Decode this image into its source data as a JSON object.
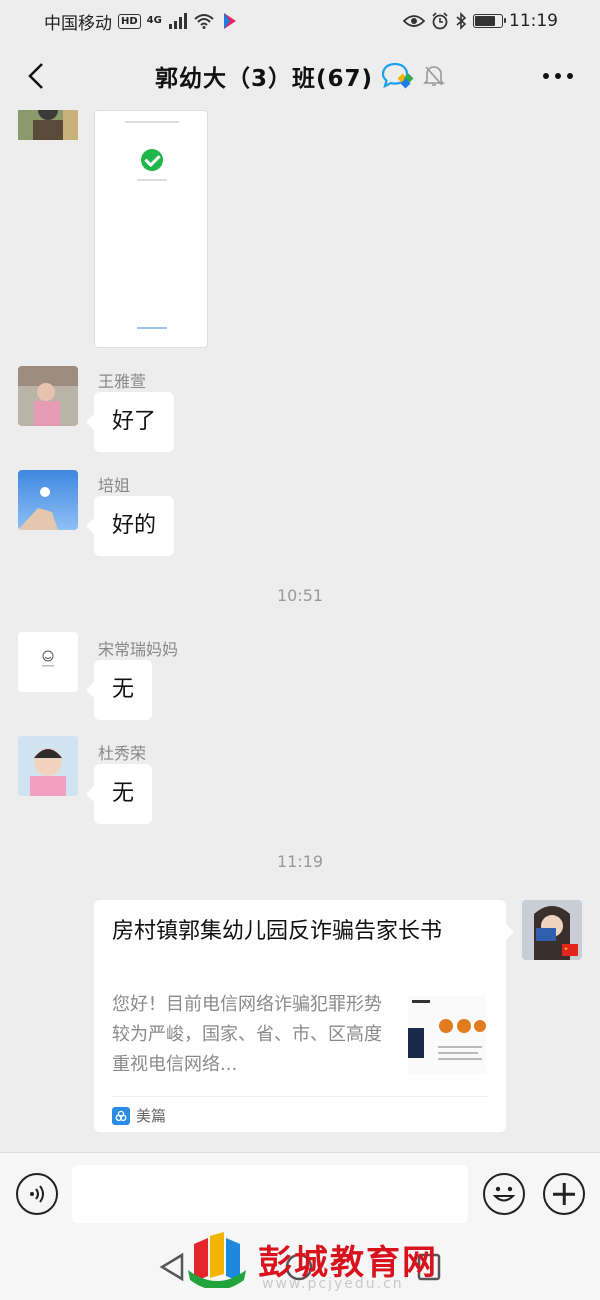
{
  "status_bar": {
    "carrier": "中国移动",
    "hd": "HD",
    "network": "4G",
    "time": "11:19",
    "icons": [
      "hd-icon",
      "signal-icon",
      "wifi-icon",
      "app-badge-icon",
      "eye-icon",
      "alarm-icon",
      "bluetooth-icon",
      "battery-icon"
    ],
    "battery_level": 0.75
  },
  "header": {
    "title": "郭幼大（3）班(67)",
    "icons": [
      "back-icon",
      "group-chat-icon",
      "mute-bell-icon",
      "more-icon"
    ]
  },
  "messages": [
    {
      "type": "image",
      "sender": "",
      "description_icon": "success-check-icon"
    },
    {
      "type": "text",
      "sender": "王雅萱",
      "text": "好了"
    },
    {
      "type": "text",
      "sender": "培姐",
      "text": "好的"
    },
    {
      "type": "time",
      "text": "10:51"
    },
    {
      "type": "text",
      "sender": "宋常瑞妈妈",
      "text": "无"
    },
    {
      "type": "text",
      "sender": "杜秀荣",
      "text": "无"
    },
    {
      "type": "time",
      "text": "11:19"
    },
    {
      "type": "link",
      "title": "房村镇郭集幼儿园反诈骗告家长书",
      "description": "您好！目前电信网络诈骗犯罪形势较为严峻，国家、省、市、区高度重视电信网络...",
      "source": "美篇"
    }
  ],
  "input_bar": {
    "placeholder": "",
    "icons": [
      "voice-icon",
      "emoji-icon",
      "plus-icon"
    ]
  },
  "watermark": {
    "text": "彭城教育网",
    "url": "www.pcjyedu.cn"
  },
  "colors": {
    "background": "#ededed",
    "bubble": "#ffffff",
    "check_green": "#1fb54a",
    "watermark_red": "#d8131e"
  }
}
